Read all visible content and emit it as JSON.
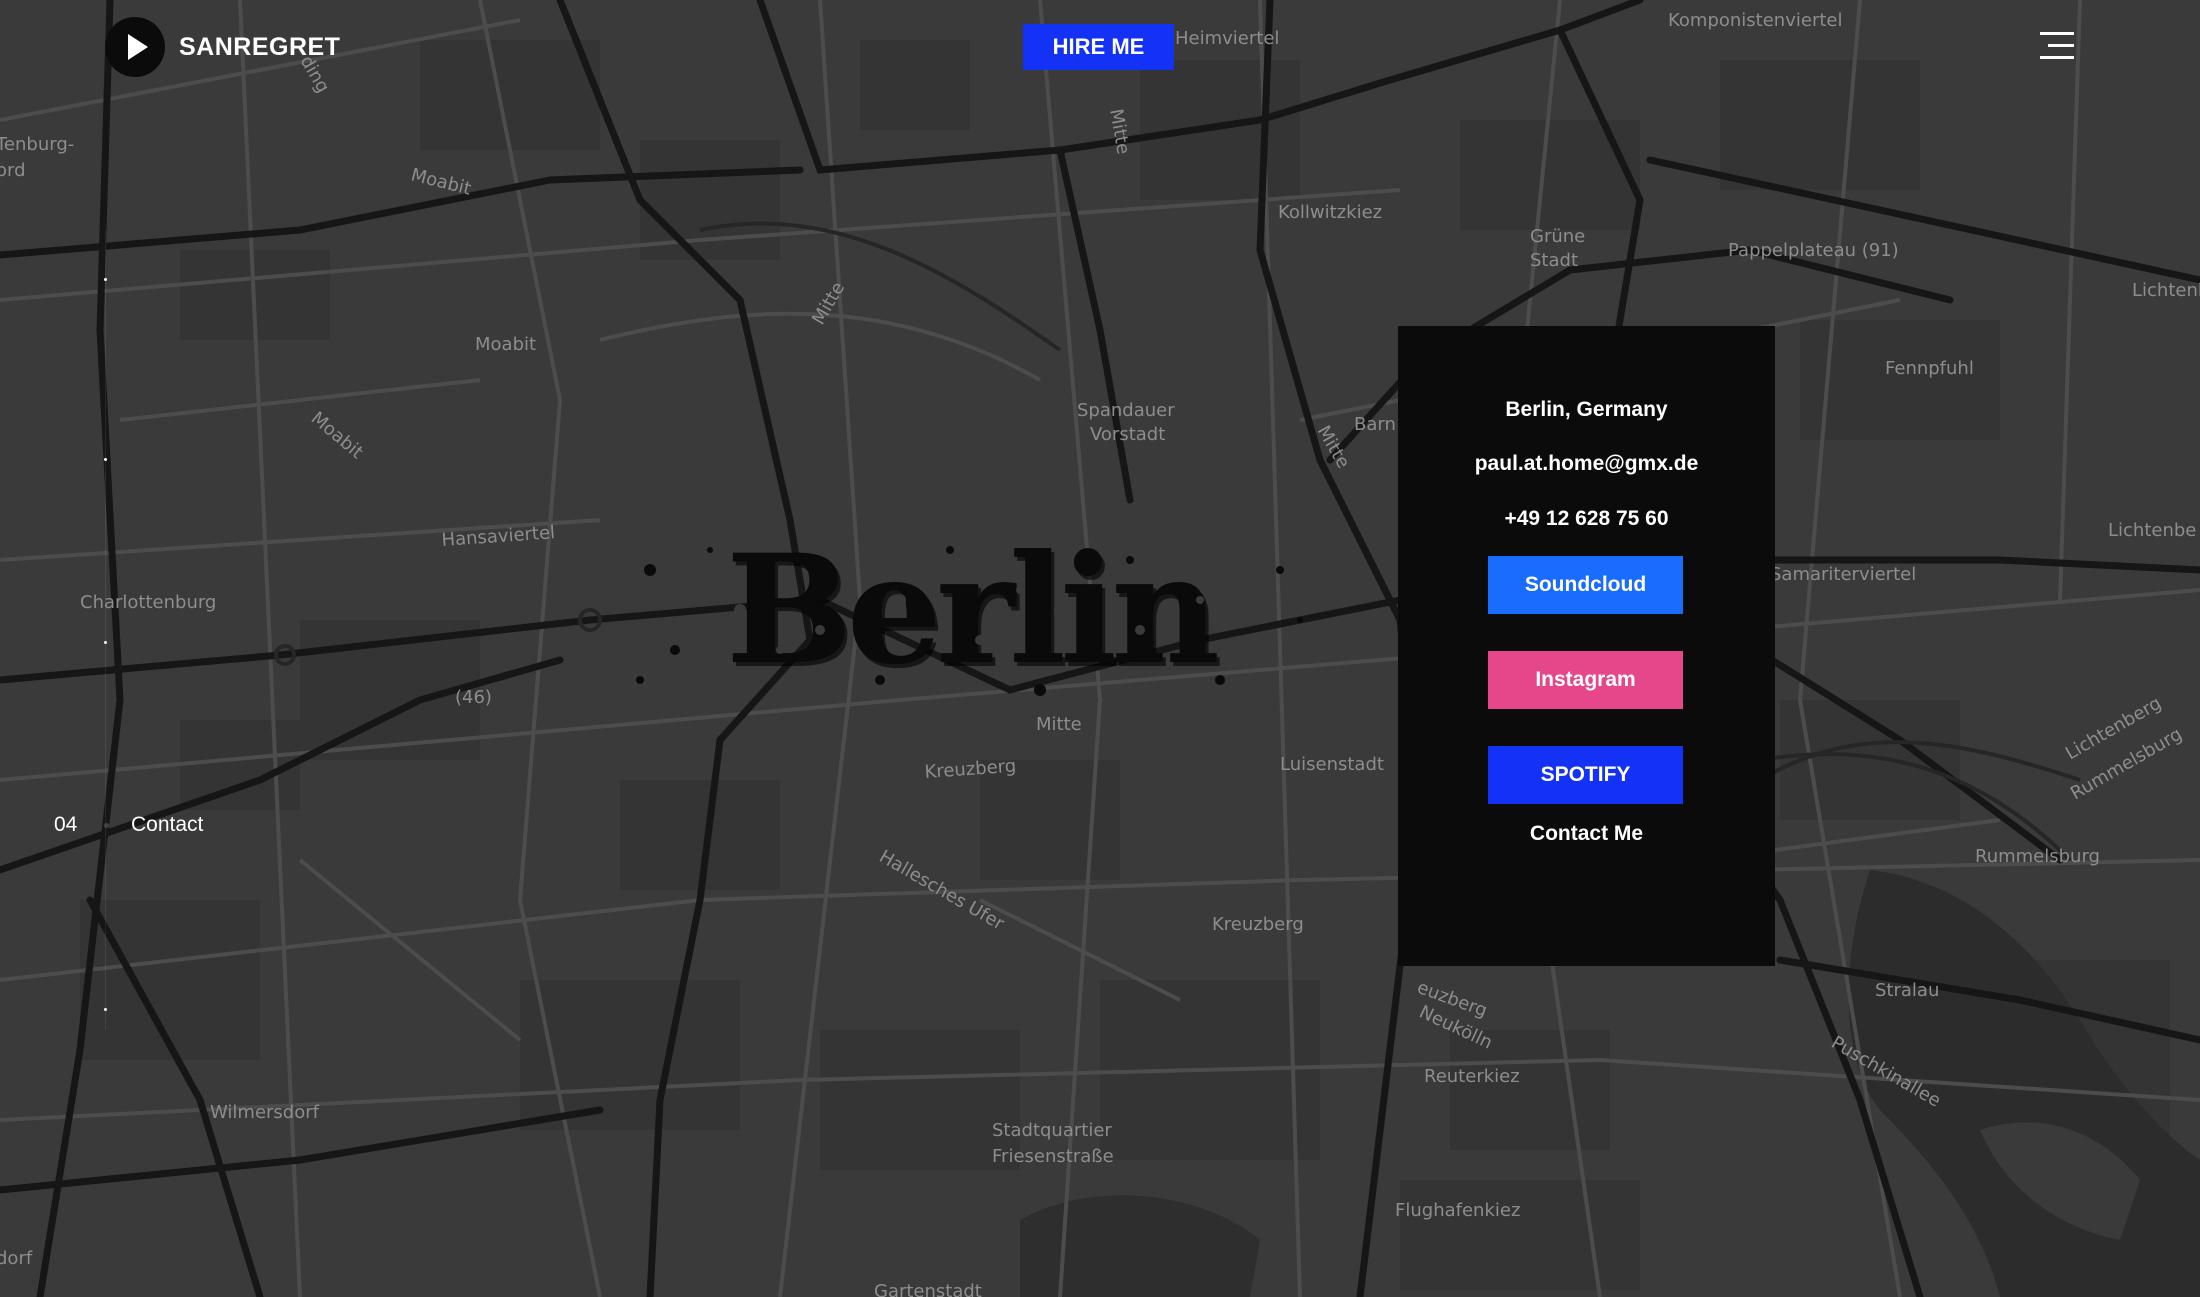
{
  "brand": {
    "name": "SANREGRET",
    "logo_icon": "play-icon"
  },
  "header": {
    "hire_label": "HIRE ME",
    "menu_icon": "hamburger-menu-icon"
  },
  "side_nav": {
    "current_number": "04",
    "current_label": "Contact"
  },
  "hero": {
    "city_title": "Berlin"
  },
  "contact": {
    "location": "Berlin, Germany",
    "email": "paul.at.home@gmx.de",
    "phone": "+49 12 628 75 60",
    "buttons": [
      {
        "label": "Soundcloud",
        "color": "#1a6cff"
      },
      {
        "label": "Instagram",
        "color": "#e6478a"
      },
      {
        "label": "SPOTIFY",
        "color": "#1432f5"
      }
    ],
    "contact_link": "Contact Me"
  },
  "map": {
    "labels": [
      "Komponistenviertel",
      "Moabit",
      "Moabit",
      "Moabit",
      "Kollwitzkiez",
      "Grüne Stadt",
      "Pappelplateau (91)",
      "Lichtenberg",
      "Fennpfuhl",
      "Mitte",
      "Mitte",
      "Mitte",
      "Mitte",
      "Spandauer Vorstadt",
      "Hansaviertel",
      "Charlottenburg",
      "(46)",
      "Kreuzberg",
      "Kreuzberg",
      "Luisenstadt",
      "Samariterviertel",
      "Lichtenberg",
      "Lichtenberg",
      "Rummelsburg",
      "Rummelsburg",
      "Stralau",
      "Puschkinallee",
      "Neukölln",
      "Reuterkiez",
      "Wilmersdorf",
      "Stadtquartier Friesenstraße",
      "Flughafenkiez",
      "Hallesches Ufer",
      "Gartenstadt",
      "Tenburg-",
      "ord",
      "dorf",
      "Barn",
      "Heimviertel"
    ]
  },
  "colors": {
    "background": "#383838",
    "panel": "#0b0b0b",
    "accent_blue": "#1432f5"
  }
}
